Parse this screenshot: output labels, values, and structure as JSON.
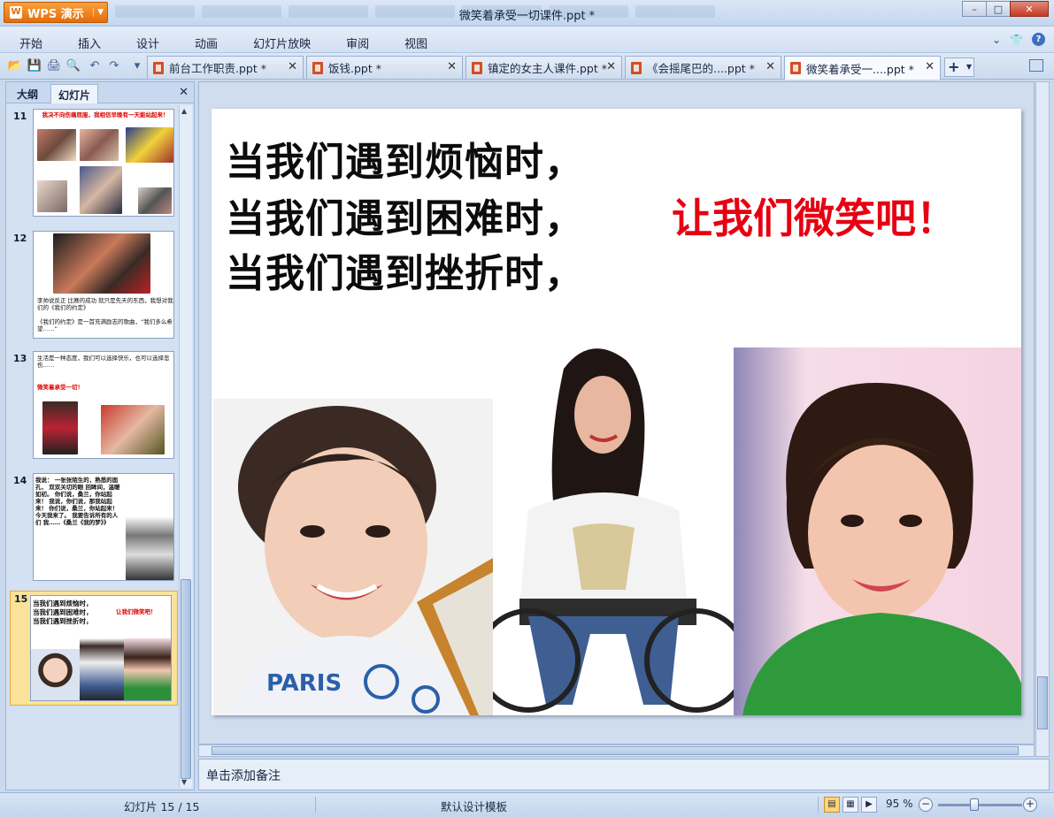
{
  "app": {
    "brand": "WPS 演示",
    "window_title": "微笑着承受一切课件.ppt *"
  },
  "menu": {
    "items": [
      "开始",
      "插入",
      "设计",
      "动画",
      "幻灯片放映",
      "审阅",
      "视图"
    ]
  },
  "doc_tabs": [
    {
      "label": "前台工作职责.ppt *",
      "active": false
    },
    {
      "label": "饭钱.ppt *",
      "active": false
    },
    {
      "label": "镇定的女主人课件.ppt *",
      "active": false
    },
    {
      "label": "《会摇尾巴的....ppt *",
      "active": false
    },
    {
      "label": "微笑着承受一....ppt *",
      "active": true
    }
  ],
  "left_pane": {
    "tab_outline": "大纲",
    "tab_slides": "幻灯片",
    "thumbnails": [
      {
        "number": "11",
        "caption_red": "我决不向伤痛屈服，我相信早晚有一天能站起来！"
      },
      {
        "number": "12",
        "caption": "李帅说反正 比赛的成功 就只是先天的东西，我想对我们的《我们的约定》",
        "caption2": "《我们的约定》是一首充满励志的歌曲，“我们多么希望……”"
      },
      {
        "number": "13",
        "caption": "生活是一种态度，我们可以选择快乐，也可以选择悲伤……",
        "caption_red": "微笑着承受一切！"
      },
      {
        "number": "14",
        "caption": "我说： 一张张陌生的，熟悉的面孔， 双双关切的眼 回眸间，温暖如初。 你们说，桑兰，你站起来！ 我说，你们说，那我站起来！ 你们说，桑兰，你站起来！ 今天我来了。 我要告诉所有的人们 我……《桑兰《我的梦》》"
      },
      {
        "number": "15",
        "lines": [
          "当我们遇到烦恼时，",
          "当我们遇到困难时，",
          "当我们遇到挫折时，"
        ],
        "caption_red": "让我们微笑吧！"
      }
    ]
  },
  "slide": {
    "lines": [
      "当我们遇到烦恼时，",
      "当我们遇到困难时，",
      "当我们遇到挫折时，"
    ],
    "highlight": "让我们微笑吧！",
    "colors": {
      "highlight": "#e60012",
      "text": "#0c0c0c"
    }
  },
  "notes": {
    "placeholder": "单击添加备注"
  },
  "status": {
    "slide_count": "幻灯片 15 / 15",
    "template": "默认设计模板",
    "zoom": "95 %"
  }
}
